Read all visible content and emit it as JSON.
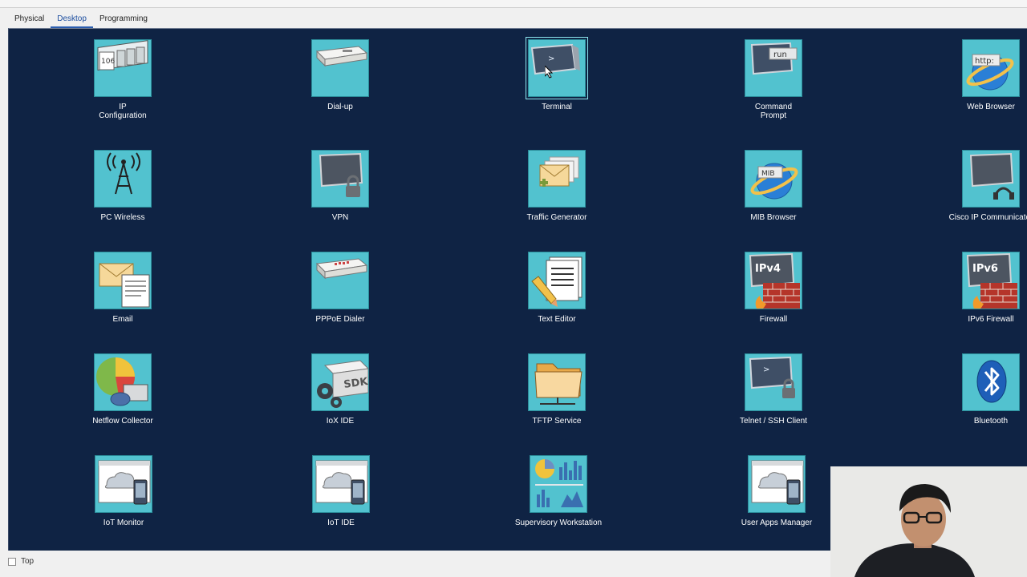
{
  "tabs": [
    "Physical",
    "Desktop",
    "Programming"
  ],
  "active_tab": "Desktop",
  "apps": {
    "ip_configuration": "IP\nConfiguration",
    "dialup": "Dial-up",
    "terminal": "Terminal",
    "command_prompt": "Command\nPrompt",
    "web_browser": "Web Browser",
    "pc_wireless": "PC Wireless",
    "vpn": "VPN",
    "traffic_generator": "Traffic Generator",
    "mib_browser": "MIB Browser",
    "cisco_ip_communicator": "Cisco IP Communicator",
    "email": "Email",
    "pppoe_dialer": "PPPoE Dialer",
    "text_editor": "Text Editor",
    "firewall": "Firewall",
    "ipv6_firewall": "IPv6 Firewall",
    "netflow_collector": "Netflow Collector",
    "iox_ide": "IoX IDE",
    "tftp_service": "TFTP Service",
    "telnet_ssh_client": "Telnet / SSH Client",
    "bluetooth": "Bluetooth",
    "iot_monitor": "IoT Monitor",
    "iot_ide": "IoT IDE",
    "supervisory_workstation": "Supervisory Workstation",
    "user_apps_manager": "User Apps Manager"
  },
  "icon_text": {
    "ip_number": "106",
    "run": "run",
    "http": "http:",
    "mib": "MIB",
    "ipv4": "IPv4",
    "ipv6": "IPv6",
    "sdk": "SDK",
    "prompt": ">"
  },
  "footer": {
    "top_label": "Top"
  },
  "colors": {
    "desktop_bg": "#0f2344",
    "tile_bg": "#52c2cf",
    "label": "#ffffff",
    "active_tab": "#1e4fa0"
  }
}
